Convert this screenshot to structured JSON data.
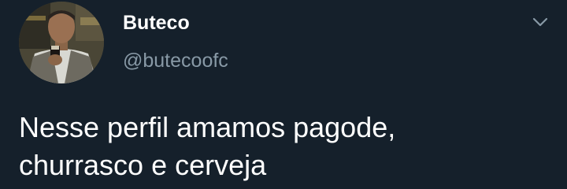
{
  "author": {
    "display_name": "Buteco",
    "handle": "@butecoofc"
  },
  "tweet": {
    "line1": "Nesse perfil amamos pagode,",
    "line2": "churrasco e cerveja"
  },
  "icons": {
    "menu": "chevron-down-icon",
    "avatar": "avatar-photo"
  },
  "colors": {
    "background": "#15202b",
    "text": "#ffffff",
    "secondary_text": "#8899a6"
  }
}
